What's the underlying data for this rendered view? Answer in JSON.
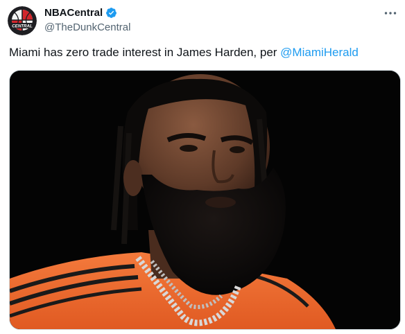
{
  "author": {
    "display_name": "NBACentral",
    "handle": "@TheDunkCentral",
    "avatar_icon": "nba-central-logo",
    "verified_icon": "verified-badge-icon",
    "verified_color": "#1d9bf0"
  },
  "tweet": {
    "text": "Miami has zero trade interest in James Harden, per ",
    "mention": "@MiamiHerald",
    "mention_color": "#1d9bf0"
  },
  "media": {
    "type": "photo",
    "background_color": "#040404",
    "shirt_color": "#f26a2e"
  },
  "menu": {
    "icon": "more-horizontal-icon"
  }
}
